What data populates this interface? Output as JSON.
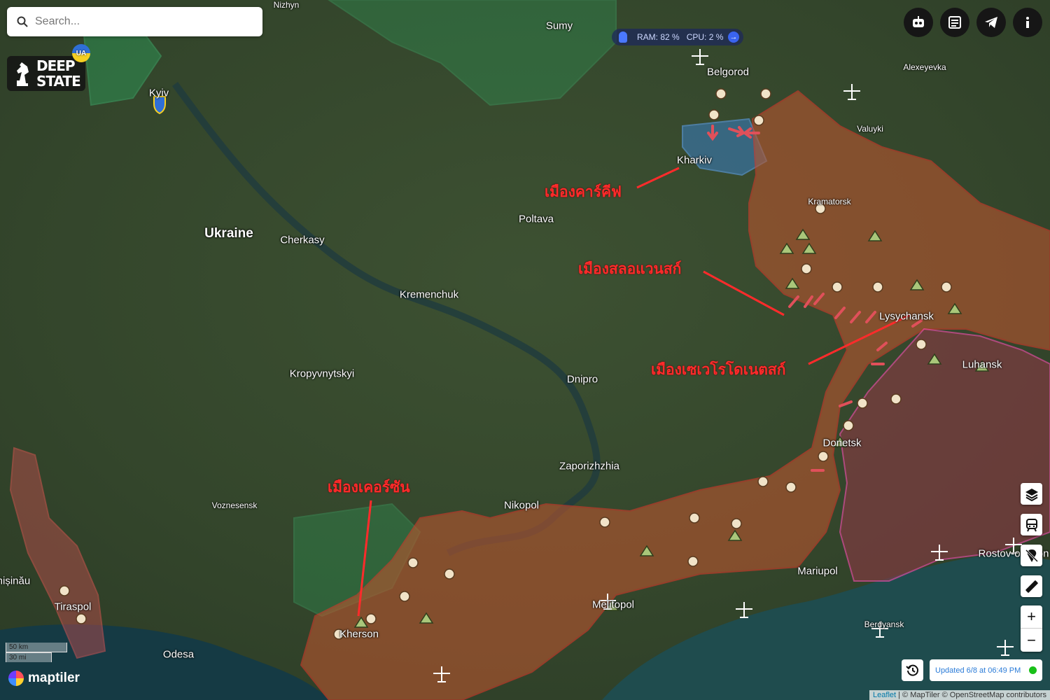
{
  "search": {
    "placeholder": "Search..."
  },
  "logo": {
    "line1": "DEEP",
    "line2": "STATE",
    "badge": "UA"
  },
  "status": {
    "ram": "RAM: 82 %",
    "cpu": "CPU: 2 %"
  },
  "cities": [
    {
      "name": "Nizhyn",
      "size": "small"
    },
    {
      "name": "Sumy",
      "size": "normal"
    },
    {
      "name": "Belgorod",
      "size": "normal"
    },
    {
      "name": "Alexeyevka",
      "size": "small"
    },
    {
      "name": "Kyiv",
      "size": "normal"
    },
    {
      "name": "Kharkiv",
      "size": "normal"
    },
    {
      "name": "Valuyki",
      "size": "small"
    },
    {
      "name": "Poltava",
      "size": "normal"
    },
    {
      "name": "Ukraine",
      "size": "country"
    },
    {
      "name": "Cherkasy",
      "size": "normal"
    },
    {
      "name": "Kremenchuk",
      "size": "normal"
    },
    {
      "name": "Kramatorsk",
      "size": "small"
    },
    {
      "name": "Lysychansk",
      "size": "normal"
    },
    {
      "name": "Kropyvnytskyi",
      "size": "normal"
    },
    {
      "name": "Dnipro",
      "size": "normal"
    },
    {
      "name": "Luhansk",
      "size": "normal"
    },
    {
      "name": "Donetsk",
      "size": "normal"
    },
    {
      "name": "Zaporizhzhia",
      "size": "normal"
    },
    {
      "name": "Voznesensk",
      "size": "small"
    },
    {
      "name": "Nikopol",
      "size": "normal"
    },
    {
      "name": "Mariupol",
      "size": "normal"
    },
    {
      "name": "Melitopol",
      "size": "normal"
    },
    {
      "name": "Rostov-on-Don",
      "size": "normal"
    },
    {
      "name": "Tiraspol",
      "size": "normal"
    },
    {
      "name": "Chișinău",
      "size": "normal"
    },
    {
      "name": "Kherson",
      "size": "normal"
    },
    {
      "name": "Odesa",
      "size": "normal"
    },
    {
      "name": "Berdyansk",
      "size": "small"
    }
  ],
  "annotations": [
    {
      "text": "เมืองคาร์คีฟ"
    },
    {
      "text": "เมืองสลอแวนสก์"
    },
    {
      "text": "เมืองเซเวโรโดเนตสก์"
    },
    {
      "text": "เมืองเคอร์ซัน"
    }
  ],
  "scale": {
    "km": "50 km",
    "mi": "30 mi"
  },
  "maptiler_label": "maptiler",
  "updated": "Updated 6/8 at 06:49 PM",
  "attribution": {
    "leaflet": "Leaflet",
    "rest": " | © MapTiler © OpenStreetMap contributors"
  },
  "colors": {
    "occupied": "#b5552f",
    "occupied_pre2022": "#8c3a44",
    "liberated": "#2bbd6a",
    "contested": "#3a7fc4",
    "annotation": "#ff2b2b"
  },
  "icons": {
    "top_buttons": [
      "robot-icon",
      "newspaper-icon",
      "telegram-icon",
      "info-icon"
    ],
    "side_buttons": [
      "layers-icon",
      "train-icon",
      "no-pin-icon",
      "ruler-icon"
    ],
    "map_markers": [
      "soldier-icon",
      "tent-icon",
      "airport-icon",
      "attack-arrow-icon"
    ]
  }
}
